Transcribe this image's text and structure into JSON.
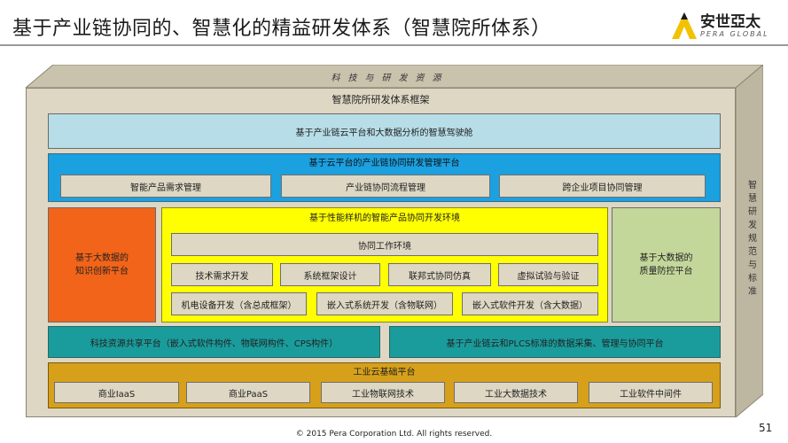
{
  "slide": {
    "title": "基于产业链协同的、智慧化的精益研发体系（智慧院所体系）",
    "logo_name": "安世亞太",
    "logo_sub": "PERA GLOBAL",
    "page_number": "51",
    "copyright": "© 2015 Pera Corporation Ltd. All rights reserved."
  },
  "diagram": {
    "top_label": "科技与研发资源",
    "side_label": "智慧研发规范与标准",
    "framework_title": "智慧院所研发体系框架",
    "cloud_cockpit": "基于产业链云平台和大数据分析的智慧驾驶舱",
    "rd_platform": {
      "title": "基于云平台的产业链协同研发管理平台",
      "items": [
        "智能产品需求管理",
        "产业链协同流程管理",
        "跨企业项目协同管理"
      ]
    },
    "innovation_platform": "基于大数据的\n知识创新平台",
    "quality_platform": "基于大数据的\n质量防控平台",
    "sample_env": {
      "title": "基于性能样机的智能产品协同开发环境",
      "collab_env": "协同工作环境",
      "items": [
        "技术需求开发",
        "系统框架设计",
        "联邦式协同仿真",
        "虚拟试验与验证",
        "机电设备开发（含总成框架）",
        "嵌入式系统开发（含物联网）",
        "嵌入式软件开发（含大数据）"
      ]
    },
    "share_platform": "科技资源共享平台（嵌入式软件构件、物联网构件、CPS构件）",
    "data_platform": "基于产业链云和PLCS标准的数据采集、管理与协同平台",
    "industry_cloud": {
      "title": "工业云基础平台",
      "items": [
        "商业IaaS",
        "商业PaaS",
        "工业物联网技术",
        "工业大数据技术",
        "工业软件中间件"
      ]
    }
  },
  "colors": {
    "cockpit": "#b7dde8",
    "rd_platform": "#1ba0e0",
    "innovation": "#f26419",
    "sample_env": "#ffff00",
    "quality": "#c4d79b",
    "share_platform": "#1a9c9c",
    "industry_cloud": "#d7a01a",
    "frame": "#ddd7c4"
  }
}
